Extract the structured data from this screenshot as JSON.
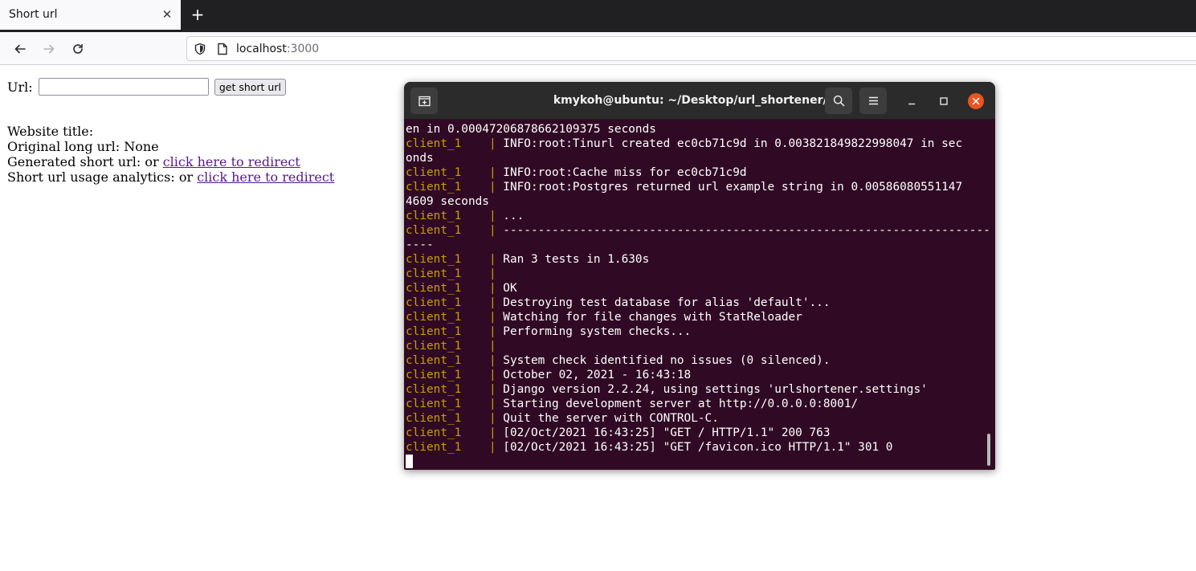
{
  "browser": {
    "tab_title": "Short url",
    "tab_close": "✕",
    "new_tab": "+",
    "url_host": "localhost",
    "url_port": ":3000"
  },
  "page": {
    "url_label": "Url:",
    "url_input_value": "",
    "submit_label": "get short url",
    "website_title_label": "Website title:",
    "website_title_value": "",
    "original_long_url_label": "Original long url:",
    "original_long_url_value": "None",
    "generated_short_url_label": "Generated short url:",
    "generated_short_url_or": "or",
    "redirect_link_1": "click here to redirect",
    "analytics_label": "Short url usage analytics:",
    "analytics_or": "or",
    "redirect_link_2": "click here to redirect"
  },
  "terminal": {
    "title": "kmykoh@ubuntu: ~/Desktop/url_shortener/src",
    "lines": [
      {
        "prefix": "",
        "text": "en in 0.00047206878662109375 seconds"
      },
      {
        "prefix": "client_1    | ",
        "text": "INFO:root:Tinurl created ec0cb71c9d in 0.003821849822998047 in sec"
      },
      {
        "prefix": "",
        "text": "onds"
      },
      {
        "prefix": "client_1    | ",
        "text": "INFO:root:Cache miss for ec0cb71c9d"
      },
      {
        "prefix": "client_1    | ",
        "text": "INFO:root:Postgres returned url example string in 0.00586080551147"
      },
      {
        "prefix": "",
        "text": "4609 seconds"
      },
      {
        "prefix": "client_1    | ",
        "text": "..."
      },
      {
        "prefix": "client_1    | ",
        "text": "----------------------------------------------------------------------"
      },
      {
        "prefix": "",
        "text": "----"
      },
      {
        "prefix": "client_1    | ",
        "text": "Ran 3 tests in 1.630s"
      },
      {
        "prefix": "client_1    | ",
        "text": ""
      },
      {
        "prefix": "client_1    | ",
        "text": "OK"
      },
      {
        "prefix": "client_1    | ",
        "text": "Destroying test database for alias 'default'..."
      },
      {
        "prefix": "client_1    | ",
        "text": "Watching for file changes with StatReloader"
      },
      {
        "prefix": "client_1    | ",
        "text": "Performing system checks..."
      },
      {
        "prefix": "client_1    | ",
        "text": ""
      },
      {
        "prefix": "client_1    | ",
        "text": "System check identified no issues (0 silenced)."
      },
      {
        "prefix": "client_1    | ",
        "text": "October 02, 2021 - 16:43:18"
      },
      {
        "prefix": "client_1    | ",
        "text": "Django version 2.2.24, using settings 'urlshortener.settings'"
      },
      {
        "prefix": "client_1    | ",
        "text": "Starting development server at http://0.0.0.0:8001/"
      },
      {
        "prefix": "client_1    | ",
        "text": "Quit the server with CONTROL-C."
      },
      {
        "prefix": "client_1    | ",
        "text": "[02/Oct/2021 16:43:25] \"GET / HTTP/1.1\" 200 763"
      },
      {
        "prefix": "client_1    | ",
        "text": "[02/Oct/2021 16:43:25] \"GET /favicon.ico HTTP/1.1\" 301 0"
      }
    ]
  },
  "colors": {
    "terminal_bg": "#300a24",
    "prefix_color": "#c4a000",
    "close_button": "#e95420",
    "link_visited": "#551a8b"
  }
}
